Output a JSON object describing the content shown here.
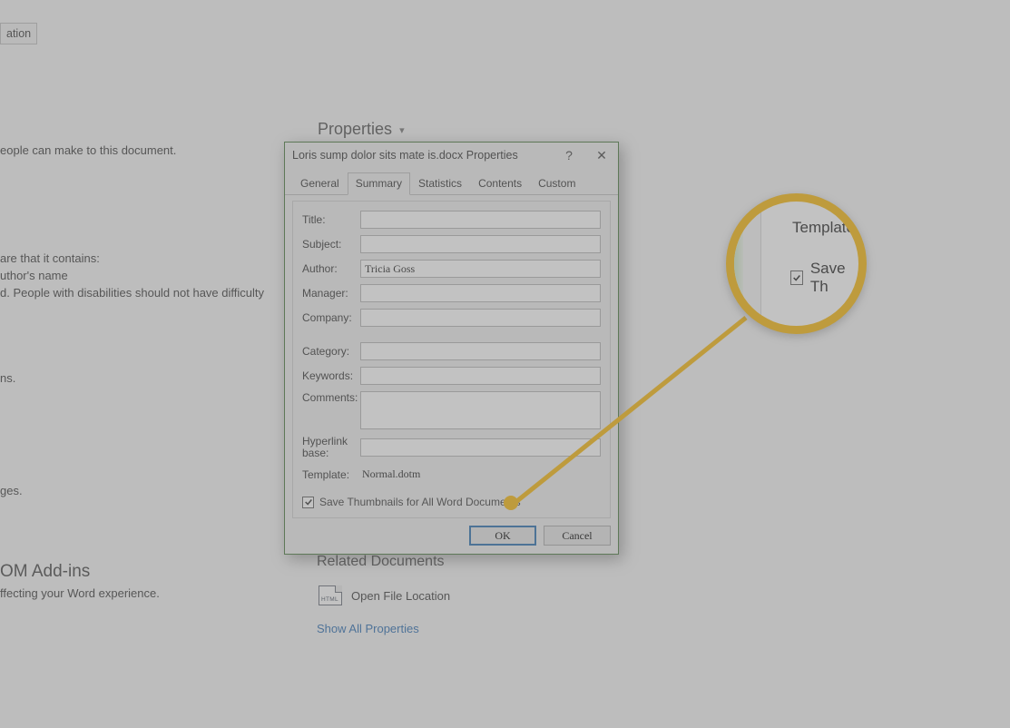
{
  "background": {
    "top_button": "ation",
    "line1": "eople can make to this document.",
    "line2": "are that it contains:",
    "line3": "uthor's name",
    "line4": "d. People with disabilities should not have difficulty",
    "line5": "ns.",
    "line6": "ges.",
    "addins_title": "OM Add-ins",
    "addins_sub": "ffecting your Word experience.",
    "properties_label": "Properties",
    "related_docs": "Related Documents",
    "open_file_loc": "Open File Location",
    "file_icon_text": "HTML",
    "show_all": "Show All Properties"
  },
  "dialog": {
    "title": "Loris sump dolor sits mate is.docx Properties",
    "tabs": [
      "General",
      "Summary",
      "Statistics",
      "Contents",
      "Custom"
    ],
    "active_tab": 1,
    "fields": {
      "title_label": "Title:",
      "subject_label": "Subject:",
      "author_label": "Author:",
      "author_value": "Tricia Goss",
      "manager_label": "Manager:",
      "company_label": "Company:",
      "category_label": "Category:",
      "keywords_label": "Keywords:",
      "comments_label": "Comments:",
      "hyperlink_label": "Hyperlink base:",
      "template_label": "Template:",
      "template_value": "Normal.dotm"
    },
    "checkbox_label": "Save Thumbnails for All Word Documents",
    "checkbox_checked": true,
    "ok": "OK",
    "cancel": "Cancel"
  },
  "zoom": {
    "line1": "Template",
    "line2": "Save Th"
  }
}
